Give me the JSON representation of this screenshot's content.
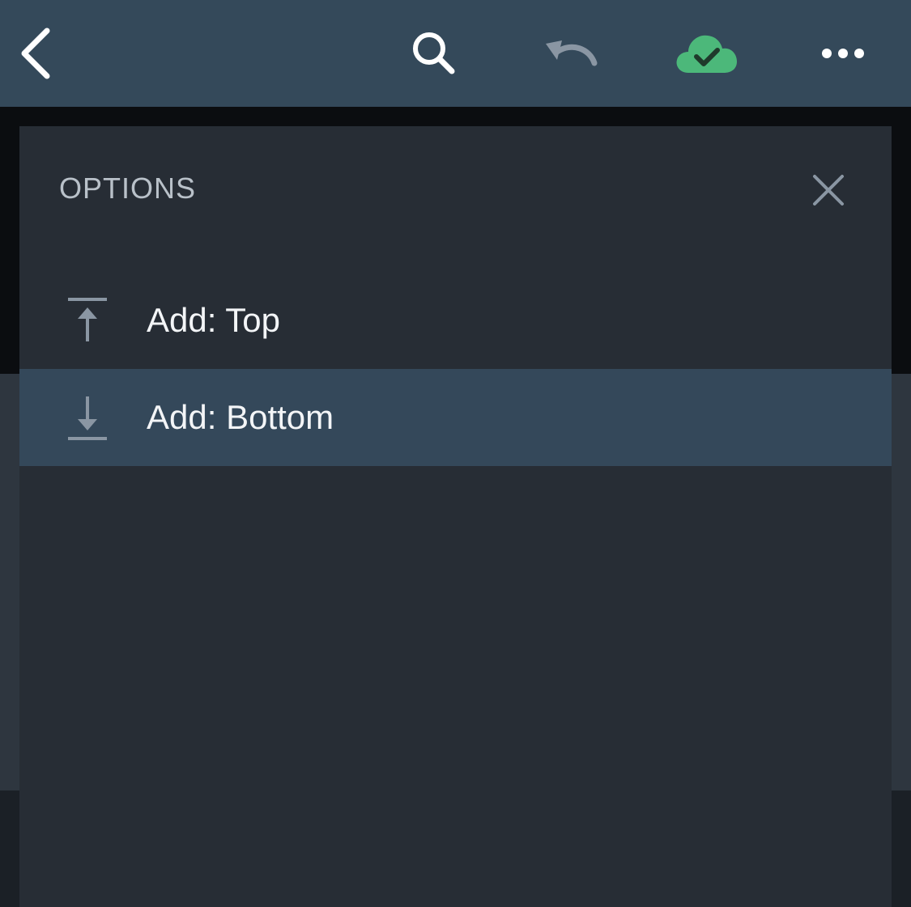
{
  "toolbar": {
    "back_icon": "chevron-left-icon",
    "search_icon": "search-icon",
    "undo_icon": "undo-icon",
    "sync_icon": "cloud-check-icon",
    "more_icon": "more-horizontal-icon",
    "sync_color": "#4cb87a"
  },
  "panel": {
    "title": "OPTIONS",
    "close_icon": "close-icon",
    "items": [
      {
        "label": "Add: Top",
        "icon": "arrow-up-to-line-icon",
        "selected": false
      },
      {
        "label": "Add: Bottom",
        "icon": "arrow-down-to-line-icon",
        "selected": true
      }
    ]
  },
  "colors": {
    "toolbar_bg": "#34495a",
    "panel_bg": "#272d35",
    "selected_bg": "#34485a",
    "muted_icon": "#8a96a3"
  }
}
